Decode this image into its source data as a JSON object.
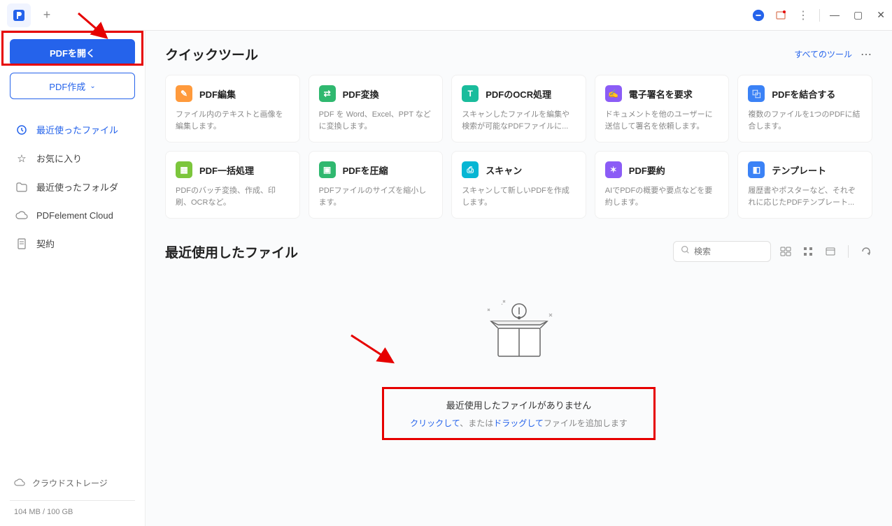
{
  "titlebar": {
    "plus": "+"
  },
  "sidebar": {
    "open_pdf": "PDFを開く",
    "create_pdf": "PDF作成",
    "nav": [
      {
        "label": "最近使ったファイル",
        "icon": "clock-icon"
      },
      {
        "label": "お気に入り",
        "icon": "star-icon"
      },
      {
        "label": "最近使ったフォルダ",
        "icon": "folder-icon"
      },
      {
        "label": "PDFelement Cloud",
        "icon": "cloud-icon"
      },
      {
        "label": "契約",
        "icon": "document-icon"
      }
    ],
    "cloud_storage": "クラウドストレージ",
    "storage": "104 MB / 100 GB"
  },
  "quick_tools": {
    "title": "クイックツール",
    "all_tools": "すべてのツール",
    "tools": [
      {
        "title": "PDF編集",
        "desc": "ファイル内のテキストと画像を編集します。",
        "color": "c-orange",
        "glyph": "✎"
      },
      {
        "title": "PDF変換",
        "desc": "PDF を Word、Excel、PPT などに変換します。",
        "color": "c-green",
        "glyph": "⇄"
      },
      {
        "title": "PDFのOCR処理",
        "desc": "スキャンしたファイルを編集や検索が可能なPDFファイルに...",
        "color": "c-teal",
        "glyph": "T"
      },
      {
        "title": "電子署名を要求",
        "desc": "ドキュメントを他のユーザーに送信して署名を依頼します。",
        "color": "c-purple",
        "glyph": "✍"
      },
      {
        "title": "PDFを結合する",
        "desc": "複数のファイルを1つのPDFに結合します。",
        "color": "c-blue",
        "glyph": "⿻"
      },
      {
        "title": "PDF一括処理",
        "desc": "PDFのバッチ変換、作成、印刷、OCRなど。",
        "color": "c-green2",
        "glyph": "▦"
      },
      {
        "title": "PDFを圧縮",
        "desc": "PDFファイルのサイズを縮小します。",
        "color": "c-green",
        "glyph": "▣"
      },
      {
        "title": "スキャン",
        "desc": "スキャンして新しいPDFを作成します。",
        "color": "c-cyan",
        "glyph": "⎙"
      },
      {
        "title": "PDF要約",
        "desc": "AIでPDFの概要や要点などを要約します。",
        "color": "c-purple",
        "glyph": "✶"
      },
      {
        "title": "テンプレート",
        "desc": "履歴書やポスターなど、それぞれに応じたPDFテンプレート...",
        "color": "c-blue",
        "glyph": "◧"
      }
    ]
  },
  "recent": {
    "title": "最近使用したファイル",
    "search_placeholder": "検索",
    "empty_title": "最近使用したファイルがありません",
    "click_text": "クリックして",
    "middle_text": "、または",
    "drag_text": "ドラッグして",
    "tail_text": "ファイルを追加します"
  }
}
